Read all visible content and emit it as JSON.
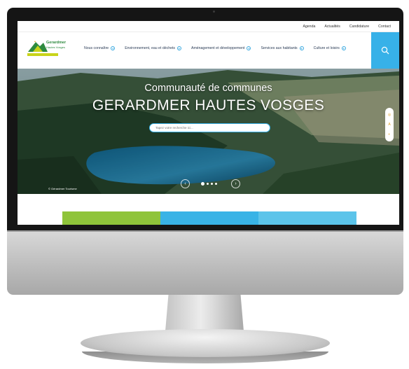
{
  "topbar": {
    "links": [
      "Agenda",
      "Actualités",
      "Candidature",
      "Contact"
    ]
  },
  "logo": {
    "name": "Gerardmer",
    "subtitle": "Hautes Vosges"
  },
  "nav": {
    "items": [
      "Nous connaître",
      "Environnement, eau et déchets",
      "Aménagement et développement",
      "Services aux habitants",
      "Culture et loisirs"
    ]
  },
  "hero": {
    "subtitle": "Communauté de communes",
    "title": "GERARDMER HAUTES VOSGES",
    "search_placeholder": "Tapez votre recherche ici...",
    "credit": "© Gérardmer Tourisme",
    "slides_total": 4,
    "slide_active": 1
  },
  "colors": {
    "accent": "#37b1e8",
    "brand_green": "#2d8a3e",
    "brand_lime": "#c8d41a",
    "tile_green": "#8fc43a",
    "tile_blue": "#39b3e6",
    "tile_cyan": "#5cc4ea"
  }
}
